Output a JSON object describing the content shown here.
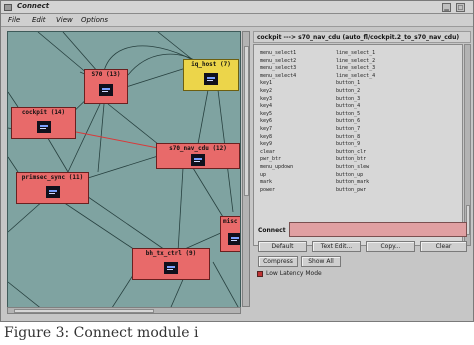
{
  "window": {
    "title": "Connect"
  },
  "menu": [
    "File",
    "Edit",
    "View",
    "Options"
  ],
  "graph": {
    "nodes": [
      {
        "id": "s70",
        "label": "S70 (13)",
        "color": "#e86a6a"
      },
      {
        "id": "iq_host",
        "label": "iq_host (7)",
        "color": "#ecd54a"
      },
      {
        "id": "cockpit",
        "label": "cockpit (14)",
        "color": "#e86a6a"
      },
      {
        "id": "s70_nav_cdu",
        "label": "s70_nav_cdu (12)",
        "color": "#e86a6a"
      },
      {
        "id": "primsec_sync",
        "label": "primsec_sync (11)",
        "color": "#e86a6a"
      },
      {
        "id": "bh_tx_ctrl",
        "label": "bh_tx_ctrl (9)",
        "color": "#e86a6a"
      },
      {
        "id": "misc",
        "label": "misc",
        "color": "#e86a6a"
      }
    ]
  },
  "connection_header": "cockpit ---> s70_nav_cdu (auto_fl/cockpit.2_to_s70_nav_cdu)",
  "mappings": [
    [
      "menu_select1",
      "line_select_1"
    ],
    [
      "menu_select2",
      "line_select_2"
    ],
    [
      "menu_select3",
      "line_select_3"
    ],
    [
      "menu_select4",
      "line_select_4"
    ],
    [
      "key1",
      "button_1"
    ],
    [
      "key2",
      "button_2"
    ],
    [
      "key3",
      "button_3"
    ],
    [
      "key4",
      "button_4"
    ],
    [
      "key5",
      "button_5"
    ],
    [
      "key6",
      "button_6"
    ],
    [
      "key7",
      "button_7"
    ],
    [
      "key8",
      "button_8"
    ],
    [
      "key9",
      "button_9"
    ],
    [
      "clear",
      "button_clr"
    ],
    [
      "pwr_btr",
      "button_btr"
    ],
    [
      "menu_updown",
      "button_slew"
    ],
    [
      "up",
      "button_up"
    ],
    [
      "mark",
      "button_mark"
    ],
    [
      "power",
      "button_pwr"
    ]
  ],
  "connect": {
    "label": "Connect",
    "value": ""
  },
  "buttons": {
    "default": "Default",
    "text_edit": "Text Edit...",
    "copy": "Copy...",
    "clear": "Clear",
    "compress": "Compress",
    "show_all": "Show All"
  },
  "low_latency": {
    "label": "Low Latency Mode",
    "checked": true
  },
  "caption": "Figure 3: Connect module i"
}
